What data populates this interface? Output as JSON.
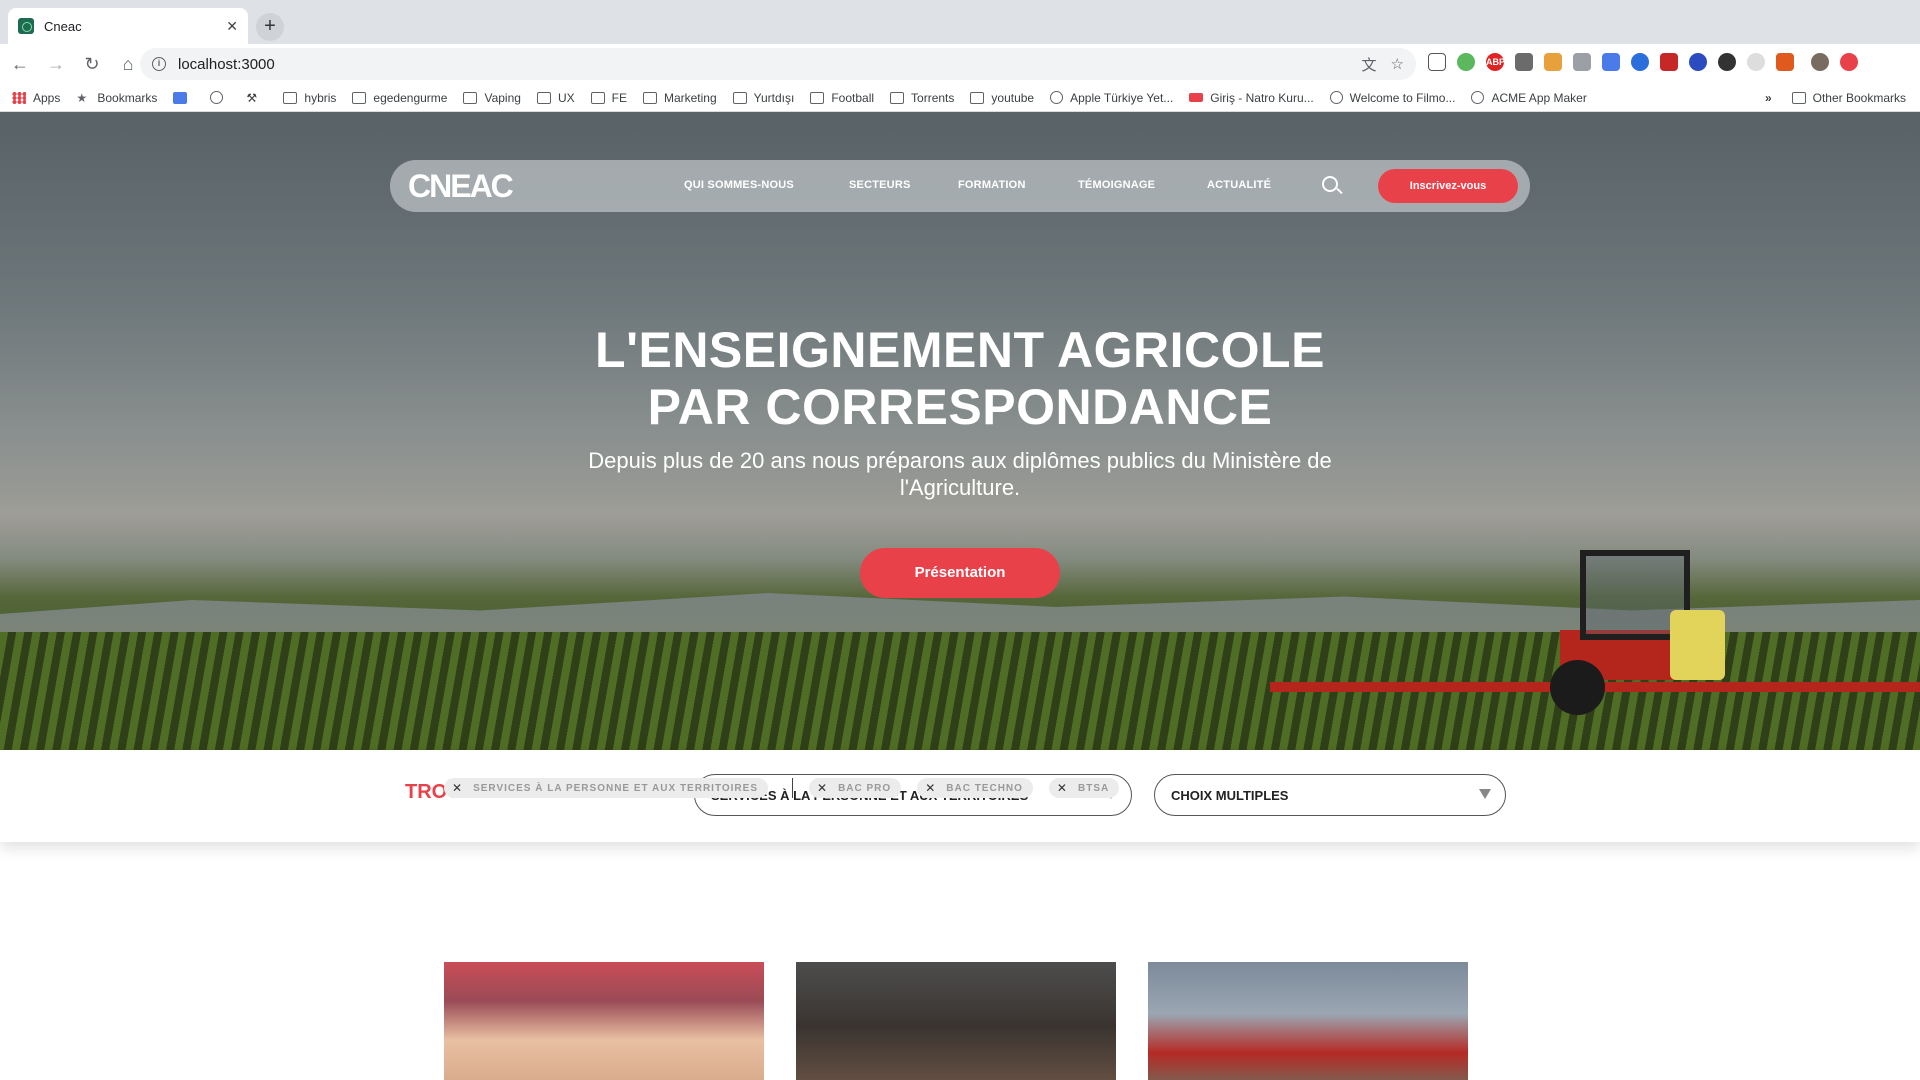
{
  "browser": {
    "tab_title": "Cneac",
    "tab_close": "✕",
    "new_tab": "+",
    "url": "localhost:3000",
    "bookmarks": [
      {
        "label": "Apps",
        "icon": "apps-grid-icon"
      },
      {
        "label": "Bookmarks",
        "icon": "star-icon"
      },
      {
        "label": "",
        "icon": "translate-icon"
      },
      {
        "label": "",
        "icon": "globe-icon"
      },
      {
        "label": "",
        "icon": "tools-icon"
      },
      {
        "label": "hybris",
        "icon": "folder-icon"
      },
      {
        "label": "egedengurme",
        "icon": "folder-icon"
      },
      {
        "label": "Vaping",
        "icon": "folder-icon"
      },
      {
        "label": "UX",
        "icon": "folder-icon"
      },
      {
        "label": "FE",
        "icon": "folder-icon"
      },
      {
        "label": "Marketing",
        "icon": "folder-icon"
      },
      {
        "label": "Yurtdışı",
        "icon": "folder-icon"
      },
      {
        "label": "Football",
        "icon": "folder-icon"
      },
      {
        "label": "Torrents",
        "icon": "folder-icon"
      },
      {
        "label": "youtube",
        "icon": "folder-icon"
      },
      {
        "label": "Apple Türkiye Yet...",
        "icon": "globe-icon"
      },
      {
        "label": "Giriş - Natro Kuru...",
        "icon": "mail-icon"
      },
      {
        "label": "Welcome to Filmo...",
        "icon": "globe-icon"
      },
      {
        "label": "ACME App Maker",
        "icon": "globe-icon"
      }
    ],
    "bookmarks_overflow": "»",
    "other_bookmarks": "Other Bookmarks"
  },
  "nav": {
    "logo": "CNEAC",
    "links": [
      "QUI SOMMES-NOUS",
      "SECTEURS",
      "FORMATION",
      "TÉMOIGNAGE",
      "ACTUALITÉ"
    ],
    "signup": "Inscrivez-vous"
  },
  "hero": {
    "title_line1": "L'ENSEIGNEMENT AGRICOLE",
    "title_line2": "PAR CORRESPONDANCE",
    "subtitle": "Depuis plus de 20 ans nous préparons aux diplômes publics du Ministère de l'Agriculture.",
    "button": "Présentation"
  },
  "finder": {
    "title": "TROUVER MA FORMATION",
    "sector_select": "SERVICES À LA PERSONNE ET AUX TERRITOIRES",
    "level_select": "CHOIX MULTIPLES"
  },
  "filters": {
    "sector": "SERVICES À LA PERSONNE ET AUX TERRITOIRES",
    "levels": [
      "BAC PRO",
      "BAC TECHNO",
      "BTSA"
    ]
  },
  "colors": {
    "accent": "#e8414a"
  }
}
